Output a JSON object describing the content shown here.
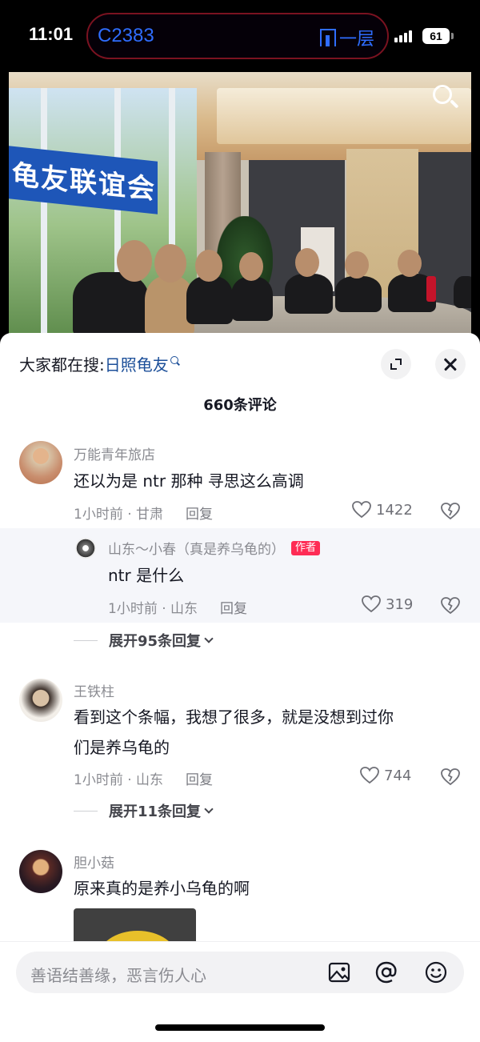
{
  "status_bar": {
    "time": "11:01",
    "island_left": "C2383",
    "island_right": "一层",
    "battery": "61"
  },
  "video": {
    "banner_text": "龟友联谊会"
  },
  "sheet": {
    "search_prefix": "大家都在搜:",
    "search_keyword": "日照龟友",
    "comment_count": "660条评论"
  },
  "comments": [
    {
      "username": "万能青年旅店",
      "text": "还以为是 ntr 那种 寻思这么高调",
      "meta": "1小时前 · 甘肃",
      "reply_label": "回复",
      "likes": "1422"
    },
    {
      "username": "王铁柱",
      "text_line1": "看到这个条幅，我想了很多，就是没想到过你",
      "text_line2": "们是养乌龟的",
      "meta": "1小时前 · 山东",
      "reply_label": "回复",
      "likes": "744",
      "expand": "展开11条回复"
    },
    {
      "username": "胆小菇",
      "text": "原来真的是养小乌龟的啊"
    }
  ],
  "reply": {
    "username": "山东～小春（真是养乌龟的）",
    "author_tag": "作者",
    "text": "ntr 是什么",
    "meta": "1小时前 · 山东",
    "reply_label": "回复",
    "likes": "319",
    "expand": "展开95条回复"
  },
  "input": {
    "placeholder": "善语结善缘，恶言伤人心"
  },
  "colors": {
    "link_blue": "#1c4f99",
    "author_red": "#fe2c55",
    "island_blue": "#2f6dff"
  }
}
